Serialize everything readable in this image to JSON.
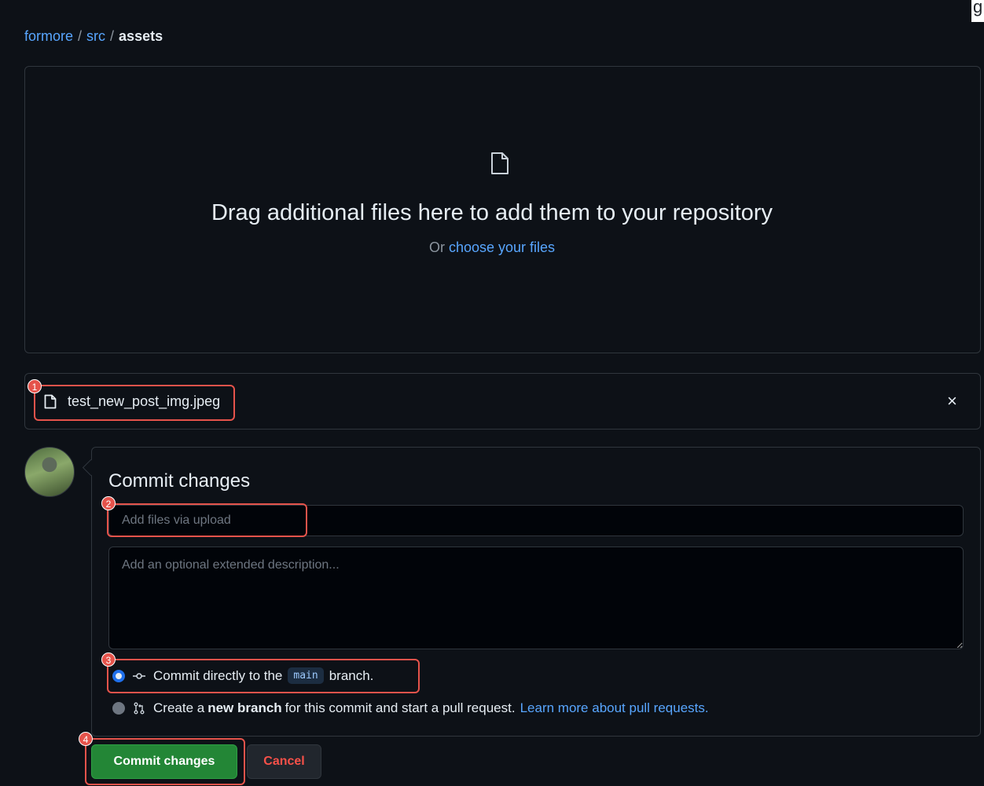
{
  "breadcrumb": {
    "repo": "formore",
    "folder": "src",
    "current": "assets",
    "separator": "/"
  },
  "dropzone": {
    "icon": "file-icon",
    "title": "Drag additional files here to add them to your repository",
    "prefix": "Or",
    "link": "choose your files"
  },
  "file": {
    "name": "test_new_post_img.jpeg",
    "remove_icon": "×"
  },
  "commit": {
    "title": "Commit changes",
    "summary_placeholder": "Add files via upload",
    "description_placeholder": "Add an optional extended description...",
    "option_direct": {
      "prefix": "Commit directly to the",
      "branch": "main",
      "suffix": "branch.",
      "selected": true
    },
    "option_new": {
      "prefix": "Create a",
      "bold": "new branch",
      "suffix": "for this commit and start a pull request.",
      "link": "Learn more about pull requests.",
      "selected": false
    },
    "commit_button": "Commit changes",
    "cancel_button": "Cancel"
  },
  "annotations": [
    "1",
    "2",
    "3",
    "4"
  ],
  "edge_text": "g",
  "colors": {
    "accent_link": "#58a6ff",
    "primary_button": "#238636",
    "danger": "#f85149",
    "annotation": "#e5534b",
    "background": "#0d1117"
  }
}
